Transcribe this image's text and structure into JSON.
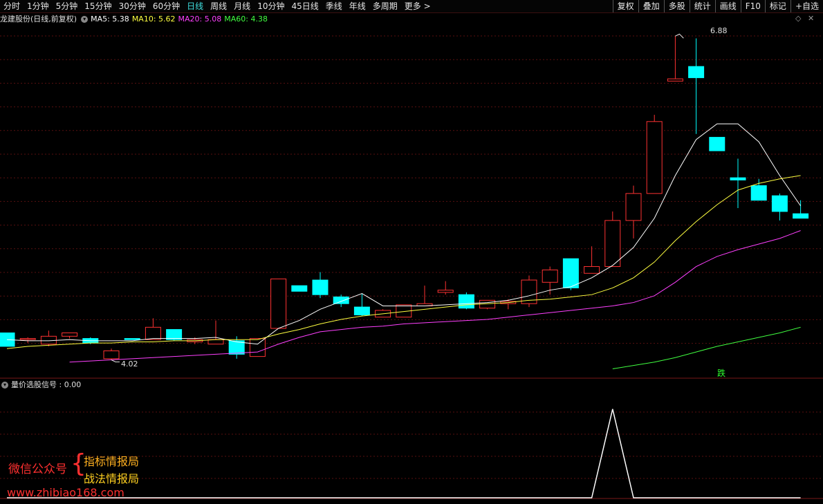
{
  "toolbar": {
    "periods": [
      "分时",
      "1分钟",
      "5分钟",
      "15分钟",
      "30分钟",
      "60分钟",
      "日线",
      "周线",
      "月线",
      "10分钟",
      "45日线",
      "季线",
      "年线",
      "多周期",
      "更多 >"
    ],
    "active_period": "日线",
    "right_items": [
      "复权",
      "叠加",
      "多股",
      "统计",
      "画线",
      "F10",
      "标记",
      "+自选"
    ]
  },
  "legend": {
    "title": "龙建股份(日线,前复权)",
    "ma5": "MA5: 5.38",
    "ma10": "MA10: 5.62",
    "ma20": "MA20: 5.08",
    "ma60": "MA60: 4.38"
  },
  "colors": {
    "up": "#ff3232",
    "down": "#00ffff",
    "ma5": "#ffffff",
    "ma10": "#ffff40",
    "ma20": "#ff40ff",
    "ma60": "#40ff40",
    "signal": "#ffffff",
    "grid": "#5a1010"
  },
  "annotations": {
    "high_label": "6.88",
    "low_label": "4.02",
    "signal_tag": "跌"
  },
  "indicator": {
    "title": "量价选股信号 : 0.00"
  },
  "watermark": {
    "line1": "微信公众号",
    "line2": "指标情报局",
    "line3": "战法情报局",
    "url": "www.zhibiao168.com"
  },
  "chart_data": {
    "type": "candlestick",
    "title": "龙建股份(日线,前复权)",
    "ohlc": [
      [
        4.26,
        4.26,
        4.14,
        4.14
      ],
      [
        4.2,
        4.22,
        4.17,
        4.21
      ],
      [
        4.16,
        4.28,
        4.14,
        4.23
      ],
      [
        4.23,
        4.26,
        4.21,
        4.26
      ],
      [
        4.21,
        4.22,
        4.16,
        4.17
      ],
      [
        4.03,
        4.12,
        4.02,
        4.1
      ],
      [
        4.21,
        4.21,
        4.2,
        4.2
      ],
      [
        4.2,
        4.39,
        4.2,
        4.31
      ],
      [
        4.29,
        4.29,
        4.19,
        4.2
      ],
      [
        4.18,
        4.22,
        4.16,
        4.2
      ],
      [
        4.16,
        4.37,
        4.16,
        4.2
      ],
      [
        4.19,
        4.23,
        4.03,
        4.07
      ],
      [
        4.05,
        4.21,
        4.05,
        4.21
      ],
      [
        4.3,
        4.74,
        4.3,
        4.74
      ],
      [
        4.68,
        4.68,
        4.63,
        4.63
      ],
      [
        4.73,
        4.8,
        4.57,
        4.6
      ],
      [
        4.58,
        4.6,
        4.49,
        4.52
      ],
      [
        4.49,
        4.61,
        4.41,
        4.42
      ],
      [
        4.4,
        4.47,
        4.4,
        4.46
      ],
      [
        4.4,
        4.51,
        4.4,
        4.51
      ],
      [
        4.5,
        4.68,
        4.5,
        4.52
      ],
      [
        4.62,
        4.72,
        4.6,
        4.64
      ],
      [
        4.6,
        4.62,
        4.47,
        4.48
      ],
      [
        4.48,
        4.55,
        4.47,
        4.55
      ],
      [
        4.52,
        4.56,
        4.47,
        4.54
      ],
      [
        4.52,
        4.77,
        4.49,
        4.73
      ],
      [
        4.71,
        4.85,
        4.6,
        4.82
      ],
      [
        4.92,
        4.92,
        4.64,
        4.66
      ],
      [
        4.79,
        5.03,
        4.79,
        4.85
      ],
      [
        4.85,
        5.34,
        4.85,
        5.26
      ],
      [
        5.26,
        5.57,
        5.1,
        5.5
      ],
      [
        5.5,
        6.2,
        5.5,
        6.14
      ],
      [
        6.5,
        6.9,
        6.5,
        6.52
      ],
      [
        6.63,
        6.88,
        6.03,
        6.53
      ],
      [
        6.0,
        6.0,
        5.88,
        5.88
      ],
      [
        5.64,
        5.81,
        5.37,
        5.62
      ],
      [
        5.57,
        5.63,
        5.44,
        5.44
      ],
      [
        5.48,
        5.5,
        5.26,
        5.34
      ],
      [
        5.32,
        5.44,
        5.28,
        5.28
      ]
    ],
    "ma5": [
      4.2,
      4.19,
      4.19,
      4.2,
      4.19,
      4.19,
      4.19,
      4.21,
      4.21,
      4.21,
      4.22,
      4.18,
      4.16,
      4.3,
      4.37,
      4.47,
      4.54,
      4.61,
      4.5,
      4.5,
      4.5,
      4.51,
      4.52,
      4.53,
      4.55,
      4.59,
      4.64,
      4.67,
      4.75,
      4.86,
      5.02,
      5.28,
      5.66,
      5.98,
      6.12,
      6.12,
      5.96,
      5.66,
      5.39
    ],
    "ma10": [
      4.12,
      4.14,
      4.15,
      4.16,
      4.17,
      4.17,
      4.18,
      4.18,
      4.19,
      4.19,
      4.2,
      4.2,
      4.2,
      4.25,
      4.29,
      4.34,
      4.38,
      4.41,
      4.43,
      4.45,
      4.47,
      4.49,
      4.51,
      4.52,
      4.53,
      4.55,
      4.56,
      4.58,
      4.6,
      4.66,
      4.75,
      4.89,
      5.08,
      5.25,
      5.4,
      5.53,
      5.59,
      5.63,
      5.66
    ],
    "ma20_x_start": 3,
    "ma20": [
      4.0,
      4.01,
      4.02,
      4.03,
      4.04,
      4.05,
      4.06,
      4.07,
      4.08,
      4.09,
      4.16,
      4.22,
      4.27,
      4.29,
      4.31,
      4.32,
      4.34,
      4.35,
      4.36,
      4.37,
      4.38,
      4.4,
      4.42,
      4.44,
      4.46,
      4.48,
      4.5,
      4.53,
      4.59,
      4.71,
      4.85,
      4.94,
      5.0,
      5.05,
      5.1,
      5.17
    ],
    "ma60_x_start": 29,
    "ma60": [
      3.94,
      3.97,
      4.0,
      4.04,
      4.09,
      4.14,
      4.18,
      4.22,
      4.26,
      4.31
    ],
    "ylim": [
      3.9,
      7.0
    ],
    "signal": [
      0,
      0,
      0,
      0,
      0,
      0,
      0,
      0,
      0,
      0,
      0,
      0,
      0,
      0,
      0,
      0,
      0,
      0,
      0,
      0,
      0,
      0,
      0,
      0,
      0,
      0,
      0,
      0,
      0,
      1,
      0,
      0,
      0,
      0,
      0,
      0,
      0,
      0,
      0
    ],
    "signal_ylim": [
      0,
      1.2
    ]
  }
}
